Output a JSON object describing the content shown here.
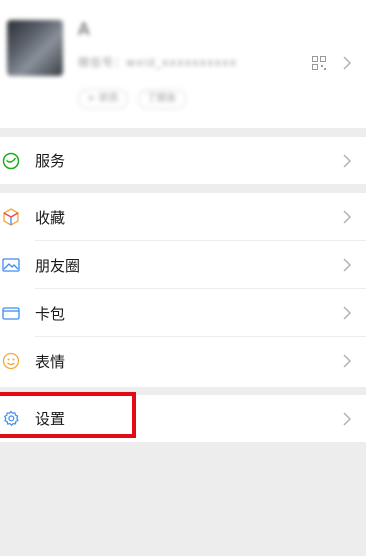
{
  "profile": {
    "nickname": "A",
    "wechat_id": "微信号：wxid_xxxxxxxxxx",
    "status_label": "+ 状态",
    "friends_label": "了朋友"
  },
  "menu": {
    "services": "服务",
    "favorites": "收藏",
    "moments": "朋友圈",
    "cards": "卡包",
    "stickers": "表情",
    "settings": "设置"
  },
  "colors": {
    "highlight": "#e00b16",
    "services_green": "#1aad19"
  }
}
